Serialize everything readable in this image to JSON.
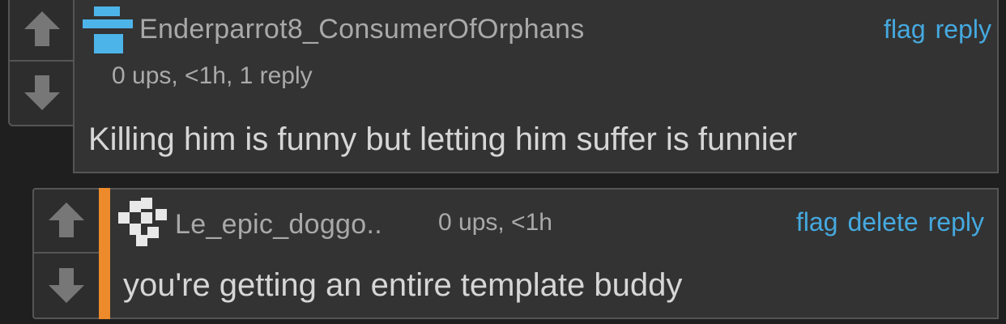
{
  "comments": [
    {
      "username": "Enderparrot8_ConsumerOfOrphans",
      "meta": "0 ups, <1h, 1 reply",
      "body": "Killing him is funny but letting him suffer is funnier",
      "actions": [
        "flag",
        "reply"
      ],
      "avatar_icon": "blue-block-avatar-icon"
    },
    {
      "username": "Le_epic_doggo..",
      "meta": "0 ups, <1h",
      "body": "you're getting an entire template buddy",
      "actions": [
        "flag",
        "delete",
        "reply"
      ],
      "avatar_icon": "checker-pattern-avatar-icon"
    }
  ],
  "colors": {
    "page_bg": "#1f1f1f",
    "box_bg": "#333333",
    "border": "#555555",
    "link": "#45a9df",
    "avatar_blue": "#4db4ea",
    "reply_accent": "#ec8a2c",
    "arrow": "#777777"
  }
}
